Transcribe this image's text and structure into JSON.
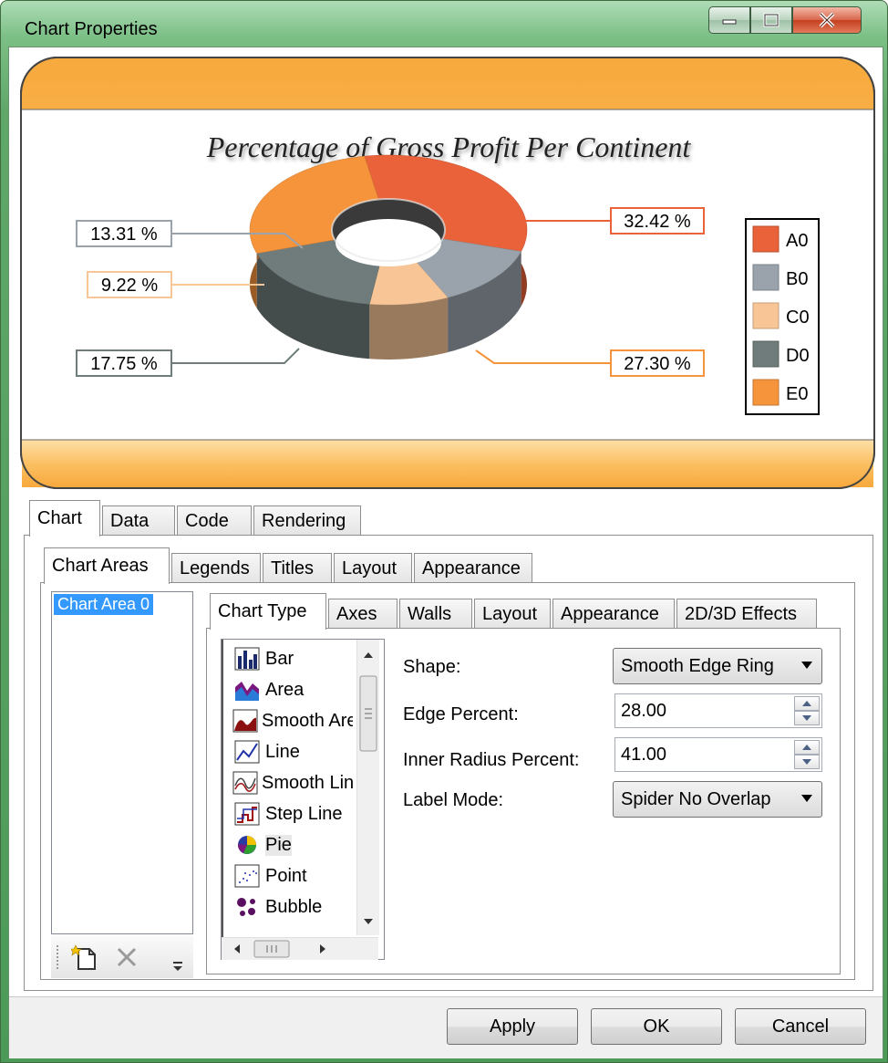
{
  "window": {
    "title": "Chart Properties"
  },
  "chart": {
    "title": "Percentage of Gross Profit Per Continent",
    "labels": {
      "a": "32.42 %",
      "b": "13.31 %",
      "c": "9.22 %",
      "d": "17.75 %",
      "e": "27.30 %"
    },
    "legend": [
      "A0",
      "B0",
      "C0",
      "D0",
      "E0"
    ],
    "colors": {
      "A0": "#e9623a",
      "B0": "#9aa3ab",
      "C0": "#f8c596",
      "D0": "#707c7b",
      "E0": "#f6943c",
      "frame": "#f9b14a"
    }
  },
  "chart_data": {
    "type": "pie",
    "title": "Percentage of Gross Profit Per Continent",
    "categories": [
      "A0",
      "B0",
      "C0",
      "D0",
      "E0"
    ],
    "values": [
      32.42,
      13.31,
      9.22,
      17.75,
      27.3
    ],
    "legend_position": "right"
  },
  "tabs": {
    "main": [
      "Chart",
      "Data",
      "Code",
      "Rendering"
    ],
    "chart": [
      "Chart Areas",
      "Legends",
      "Titles",
      "Layout",
      "Appearance"
    ],
    "area": [
      "Chart Type",
      "Axes",
      "Walls",
      "Layout",
      "Appearance",
      "2D/3D Effects"
    ]
  },
  "areas": {
    "selected": "Chart Area 0"
  },
  "chart_types": [
    {
      "label": "Bar",
      "icon": "bar-chart-icon"
    },
    {
      "label": "Area",
      "icon": "area-chart-icon"
    },
    {
      "label": "Smooth Area",
      "icon": "smooth-area-icon"
    },
    {
      "label": "Line",
      "icon": "line-chart-icon"
    },
    {
      "label": "Smooth Line",
      "icon": "smooth-line-icon"
    },
    {
      "label": "Step Line",
      "icon": "step-line-icon"
    },
    {
      "label": "Pie",
      "icon": "pie-chart-icon"
    },
    {
      "label": "Point",
      "icon": "point-chart-icon"
    },
    {
      "label": "Bubble",
      "icon": "bubble-chart-icon"
    }
  ],
  "props": {
    "shape_label": "Shape:",
    "shape_value": "Smooth Edge Ring",
    "edge_label": "Edge Percent:",
    "edge_value": "28.00",
    "inner_label": "Inner Radius Percent:",
    "inner_value": "41.00",
    "label_mode_label": "Label Mode:",
    "label_mode_value": "Spider No Overlap"
  },
  "buttons": {
    "apply": "Apply",
    "ok": "OK",
    "cancel": "Cancel"
  }
}
